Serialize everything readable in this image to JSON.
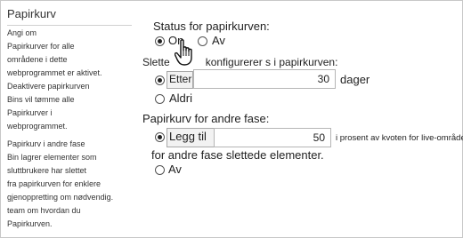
{
  "left": {
    "title": "Papirkurv",
    "lines1": [
      "Angi om",
      "Papirkurver for alle",
      "områdene i dette",
      "webprogrammet er aktivet.",
      "Deaktivere papirkurven",
      "Bins vil tømme alle",
      "Papirkurver i",
      "webprogrammet."
    ],
    "lines2": [
      "Papirkurv i andre fase",
      "Bin lagrer elementer som",
      "sluttbrukere har slettet",
      "fra papirkurven for enklere",
      "gjenoppretting om nødvendig.",
      "team om hvordan du",
      "Papirkurven."
    ]
  },
  "status": {
    "heading": "Status for papirkurven:",
    "on_label": "On",
    "off_label": "Av",
    "selected": "on"
  },
  "delete": {
    "heading_start": "Slette",
    "heading_end": "konfigurerer s i papirkurven:",
    "after_label": "Etter",
    "after_value": "30",
    "unit": "dager",
    "never_label": "Aldri",
    "selected": "after"
  },
  "second": {
    "heading": "Papirkurv for andre fase:",
    "add_label": "Legg til",
    "add_value": "50",
    "quota_text": "i prosent av kvoten for live-områder",
    "desc": "for andre fase slettede elementer.",
    "off_label": "Av",
    "selected": "add"
  }
}
